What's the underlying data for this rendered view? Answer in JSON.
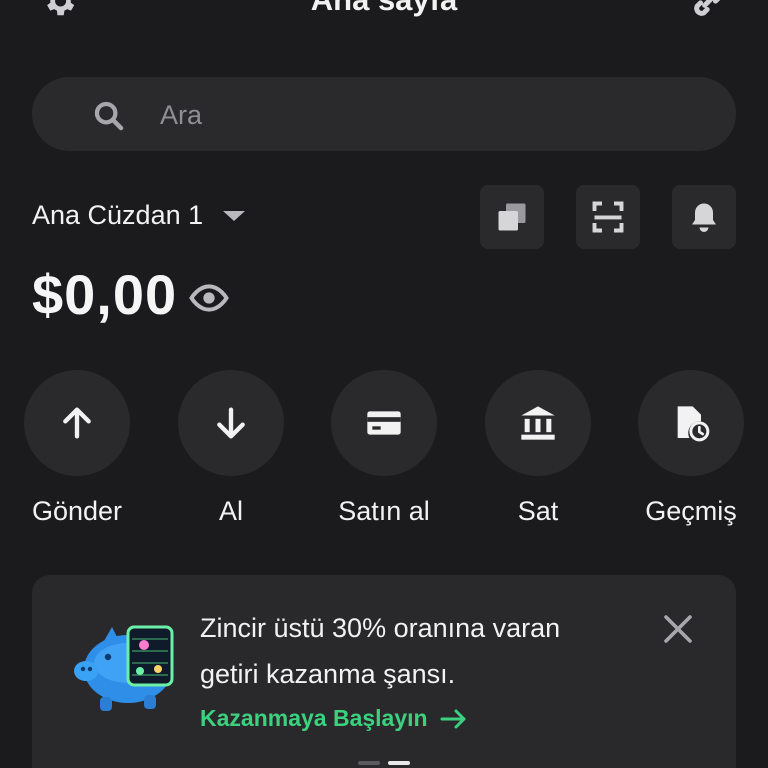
{
  "header": {
    "title": "Ana sayfa",
    "settings_icon": "gear-icon",
    "connect_icon": "link-icon"
  },
  "search": {
    "placeholder": "Ara",
    "value": ""
  },
  "wallet": {
    "name": "Ana Cüzdan 1",
    "balance": "$0,00",
    "header_actions": [
      "copy-icon",
      "scan-icon",
      "bell-icon"
    ]
  },
  "actions": [
    {
      "label": "Gönder",
      "icon": "arrow-up-icon"
    },
    {
      "label": "Al",
      "icon": "arrow-down-icon"
    },
    {
      "label": "Satın al",
      "icon": "card-icon"
    },
    {
      "label": "Sat",
      "icon": "bank-icon"
    },
    {
      "label": "Geçmiş",
      "icon": "history-icon"
    }
  ],
  "promo": {
    "line1": "Zincir üstü 30% oranına varan",
    "line2": "getiri kazanma şansı.",
    "cta": "Kazanmaya Başlayın",
    "icon": "piggy-bank-icon"
  },
  "colors": {
    "background": "#1b1b1d",
    "surface": "#2a2a2d",
    "accent_green": "#3bd17e",
    "text": "#f2f2f2",
    "muted": "#8f8f93"
  }
}
